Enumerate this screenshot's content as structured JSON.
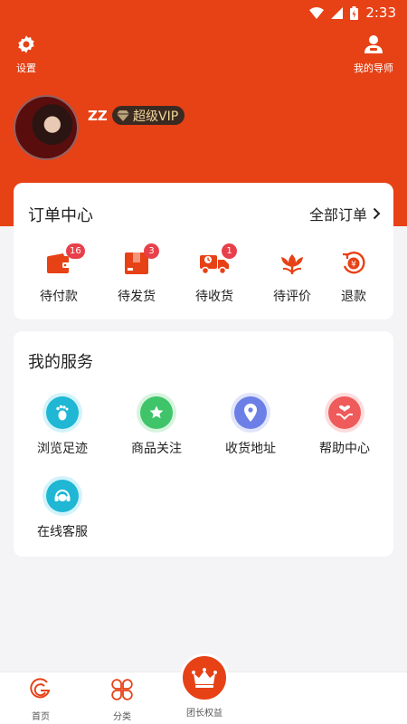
{
  "status_bar": {
    "time": "2:33"
  },
  "header": {
    "settings_label": "设置",
    "mentor_label": "我的导师",
    "username": "ZZ",
    "vip_label": "超级VIP"
  },
  "orders": {
    "title": "订单中心",
    "all_label": "全部订单",
    "items": [
      {
        "label": "待付款",
        "badge": "16",
        "icon": "wallet-icon"
      },
      {
        "label": "待发货",
        "badge": "3",
        "icon": "box-icon"
      },
      {
        "label": "待收货",
        "badge": "1",
        "icon": "truck-icon"
      },
      {
        "label": "待评价",
        "badge": "",
        "icon": "flower-icon"
      },
      {
        "label": "退款",
        "badge": "",
        "icon": "refund-icon"
      }
    ]
  },
  "services": {
    "title": "我的服务",
    "items": [
      {
        "label": "浏览足迹",
        "icon": "footprint-icon",
        "color": "#1fb7d4"
      },
      {
        "label": "商品关注",
        "icon": "star-icon",
        "color": "#3fc46a"
      },
      {
        "label": "收货地址",
        "icon": "location-icon",
        "color": "#6c7fe6"
      },
      {
        "label": "帮助中心",
        "icon": "help-hand-icon",
        "color": "#ef5a5a"
      },
      {
        "label": "在线客服",
        "icon": "headset-icon",
        "color": "#1fb7d4"
      }
    ]
  },
  "tabbar": {
    "home_label": "首页",
    "category_label": "分类",
    "benefits_label": "团长权益"
  },
  "colors": {
    "brand": "#e74116",
    "badge": "#e8404a",
    "vip_text": "#f0d69a"
  }
}
